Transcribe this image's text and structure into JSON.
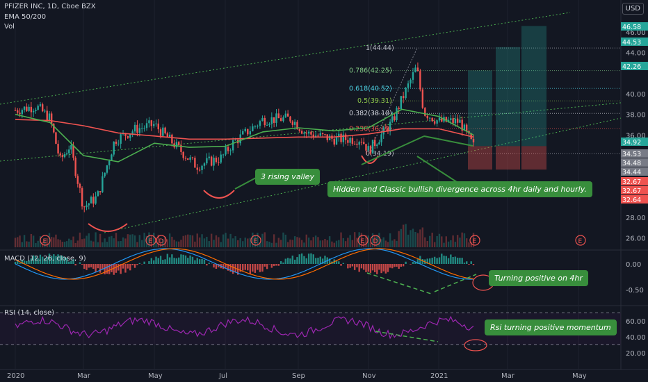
{
  "header": {
    "symbol_line": "PFIZER INC, 1D, Cboe BZX",
    "ema_label": "EMA 50/200",
    "vol_label": "Vol",
    "currency": "USD"
  },
  "annotations": {
    "rising_valley": "3 rising valley",
    "divergence": "Hidden and Classic bullish divergence across 4hr daily and hourly.",
    "macd_note": "Turning positive on 4hr",
    "rsi_note": "Rsi turning positive momentum"
  },
  "indicators": {
    "macd_label": "MACD (12, 26, close, 9)",
    "rsi_label": "RSI (14, close)",
    "earnings_marker": "E",
    "dividend_marker": "D"
  },
  "fib_levels": [
    {
      "label": "1(44.44)",
      "color": "#b2b5be"
    },
    {
      "label": "0.786(42.25)",
      "color": "#81c784"
    },
    {
      "label": "0.618(40.52)",
      "color": "#4dd0e1"
    },
    {
      "label": "0.5(39.31)",
      "color": "#8bc34a"
    },
    {
      "label": "0.382(38.10)",
      "color": "#d1d4dc"
    },
    {
      "label": "0.236(36.60)",
      "color": "#ef5350"
    },
    {
      "label": "0(34.19)",
      "color": "#b2b5be"
    }
  ],
  "price_axis": {
    "ticks": [
      "46.00",
      "44.00",
      "40.00",
      "38.00",
      "36.00",
      "28.00",
      "26.00"
    ],
    "tags": [
      {
        "label": "46.58",
        "color": "#26a69a"
      },
      {
        "label": "44.53",
        "color": "#26a69a"
      },
      {
        "label": "42.26",
        "color": "#26a69a"
      },
      {
        "label": "34.92",
        "color": "#26a69a"
      },
      {
        "label": "34.53",
        "color": "#787b86"
      },
      {
        "label": "34.48",
        "color": "#787b86"
      },
      {
        "label": "34.44",
        "color": "#787b86"
      },
      {
        "label": "32.67",
        "color": "#ef5350"
      },
      {
        "label": "32.67",
        "color": "#ef5350"
      },
      {
        "label": "32.64",
        "color": "#ef5350"
      }
    ]
  },
  "macd_axis": [
    "0.00",
    "-0.50"
  ],
  "rsi_axis": [
    "60.00",
    "40.00",
    "20.00"
  ],
  "time_axis": [
    "2020",
    "Mar",
    "May",
    "Jul",
    "Sep",
    "Nov",
    "2021",
    "Mar",
    "May"
  ],
  "colors": {
    "up": "#26a69a",
    "down": "#ef5350",
    "ema50": "#4caf50",
    "ema200": "#ef5350",
    "rsi": "#9c27b0",
    "macd": "#2196f3",
    "signal": "#ff6d00"
  },
  "chart_data": {
    "type": "candlestick",
    "title": "PFIZER INC, 1D, Cboe BZX",
    "x": [
      "2020-01",
      "2020-02",
      "2020-03",
      "2020-04",
      "2020-05",
      "2020-06",
      "2020-07",
      "2020-08",
      "2020-09",
      "2020-10",
      "2020-11",
      "2020-12",
      "2021-01",
      "2021-02"
    ],
    "series": [
      {
        "name": "close",
        "values": [
          38.8,
          36.2,
          30.5,
          34.2,
          37.0,
          33.2,
          35.8,
          38.0,
          37.0,
          36.5,
          37.5,
          41.5,
          37.0,
          34.9
        ]
      },
      {
        "name": "EMA 50",
        "values": [
          38.0,
          37.2,
          34.0,
          33.4,
          35.2,
          34.8,
          34.9,
          36.3,
          36.7,
          36.4,
          36.7,
          38.5,
          37.8,
          36.0
        ]
      },
      {
        "name": "EMA 200",
        "values": [
          37.5,
          37.4,
          36.9,
          36.2,
          35.9,
          35.6,
          35.6,
          35.7,
          35.8,
          35.8,
          36.1,
          36.6,
          36.6,
          35.8
        ]
      }
    ],
    "fibonacci": {
      "0": 34.19,
      "0.236": 36.6,
      "0.382": 38.1,
      "0.5": 39.31,
      "0.618": 40.52,
      "0.786": 42.25,
      "1": 44.44
    },
    "targets": [
      42.26,
      44.53,
      46.58
    ],
    "last_price": 34.92,
    "ylim": [
      25,
      47.5
    ],
    "rsi_ylim": [
      15,
      75
    ],
    "grid": true
  }
}
